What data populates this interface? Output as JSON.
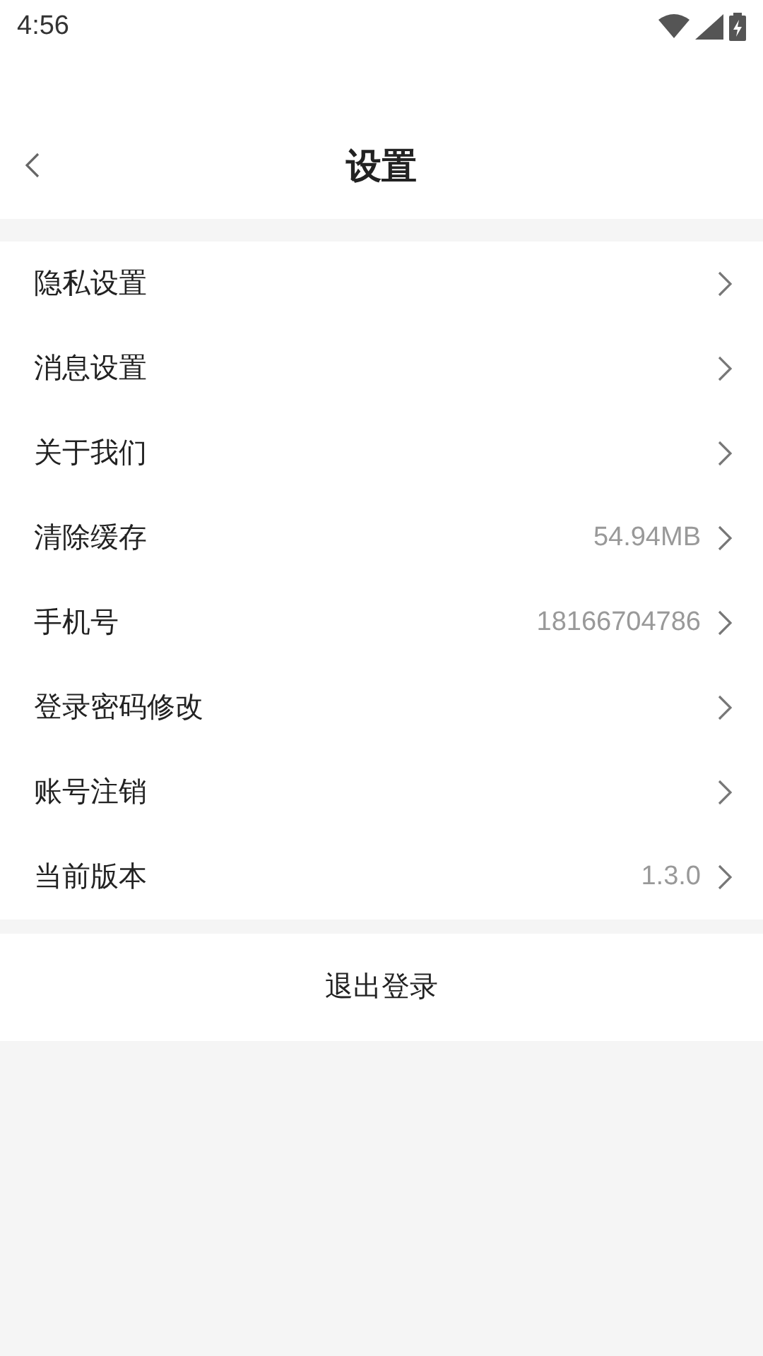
{
  "status_bar": {
    "time": "4:56"
  },
  "header": {
    "title": "设置"
  },
  "items": [
    {
      "label": "隐私设置"
    },
    {
      "label": "消息设置"
    },
    {
      "label": "关于我们"
    },
    {
      "label": "清除缓存",
      "value": "54.94MB"
    },
    {
      "label": "手机号",
      "value": "18166704786"
    },
    {
      "label": "登录密码修改"
    },
    {
      "label": "账号注销"
    },
    {
      "label": "当前版本",
      "value": "1.3.0"
    }
  ],
  "logout_button": "退出登录"
}
